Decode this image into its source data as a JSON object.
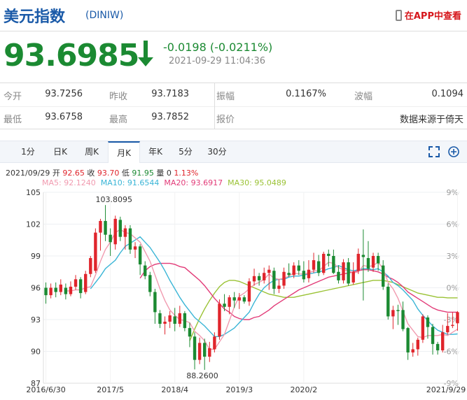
{
  "header": {
    "title": "美元指数",
    "code": "(DINIW)",
    "app_link": "在APP中查看"
  },
  "quote": {
    "price": "93.6985",
    "change": "-0.0198 (-0.0211%)",
    "datetime": "2021-09-29 11:04:36"
  },
  "stats": {
    "open_label": "今开",
    "open": "93.7256",
    "prev_label": "昨收",
    "prev": "93.7183",
    "amp_label": "振幅",
    "amp": "0.1167%",
    "wave_label": "波幅",
    "wave": "0.1094",
    "low_label": "最低",
    "low": "93.6758",
    "high_label": "最高",
    "high": "93.7852",
    "quote_label": "报价",
    "source": "数据来源于倚天"
  },
  "tabs": [
    "1分",
    "日K",
    "周K",
    "月K",
    "年K",
    "5分",
    "30分"
  ],
  "active_tab": "月K",
  "candle_info": {
    "date": "2021/09/29",
    "open_l": "开",
    "open": "92.65",
    "close_l": "收",
    "close": "93.70",
    "low_l": "低",
    "low": "91.95",
    "vol_l": "量",
    "vol": "0",
    "pct": "1.13%"
  },
  "ma_info": {
    "ma5": "MA5: 92.1240",
    "ma10": "MA10: 91.6544",
    "ma20": "MA20: 93.6917",
    "ma30": "MA30: 95.0489"
  },
  "chart_data": {
    "type": "candlestick",
    "y_ticks": [
      "105",
      "102",
      "99",
      "96",
      "93",
      "90",
      "87"
    ],
    "pct_ticks": [
      "9%",
      "6%",
      "3%",
      "0%",
      "-3%",
      "-6%",
      "-9%"
    ],
    "x_ticks": [
      "2016/6/30",
      "2017/5",
      "2018/4",
      "2019/3",
      "2020/2",
      "2021/9/29"
    ],
    "ylim": [
      87,
      105
    ],
    "annotations": {
      "max": "103.8095",
      "min": "88.2600"
    },
    "candles": [
      [
        96,
        95.3,
        96.5,
        94.5
      ],
      [
        95.3,
        96,
        96.4,
        95
      ],
      [
        96,
        95.6,
        96.5,
        95.1
      ],
      [
        95.6,
        96.3,
        96.8,
        95.3
      ],
      [
        96,
        95.4,
        96.4,
        94.9
      ],
      [
        95.4,
        96.1,
        96.6,
        95.2
      ],
      [
        96.1,
        96.8,
        97.2,
        95.8
      ],
      [
        96.8,
        95.5,
        97,
        95
      ],
      [
        95.6,
        97.3,
        97.6,
        95.4
      ],
      [
        97.3,
        98.8,
        99,
        97
      ],
      [
        97.6,
        101.2,
        101.6,
        97.4
      ],
      [
        101.2,
        102.3,
        102.5,
        99.5
      ],
      [
        102.3,
        101,
        103.8,
        100.4
      ],
      [
        101,
        100.3,
        101.6,
        99
      ],
      [
        100.1,
        102.5,
        102.8,
        99.6
      ],
      [
        102.4,
        100.8,
        102.7,
        100.4
      ],
      [
        100.8,
        101.6,
        101.9,
        99.6
      ],
      [
        101.6,
        99.6,
        101.9,
        99.2
      ],
      [
        99.6,
        99.9,
        100.3,
        98.8
      ],
      [
        99.9,
        98.2,
        100.1,
        97.2
      ],
      [
        98.1,
        97.1,
        98.5,
        96.8
      ],
      [
        97.2,
        95.6,
        97.5,
        95.2
      ],
      [
        95.6,
        93.7,
        95.9,
        92.6
      ],
      [
        93.6,
        92.6,
        93.9,
        92.2
      ],
      [
        92.6,
        92.8,
        93.3,
        91.6
      ],
      [
        92.8,
        93.4,
        93.8,
        92.2
      ],
      [
        93.3,
        92.6,
        94.1,
        91.9
      ],
      [
        92.6,
        93.6,
        94.3,
        92.3
      ],
      [
        93.6,
        92.2,
        93.8,
        91.9
      ],
      [
        92.2,
        91.4,
        92.7,
        90.4
      ],
      [
        91.4,
        89.2,
        91.8,
        88.3
      ],
      [
        89.2,
        90.8,
        91.3,
        88.8
      ],
      [
        90.8,
        89.5,
        91.2,
        88.26
      ],
      [
        89.5,
        90.3,
        90.9,
        89.0
      ],
      [
        90.2,
        91.4,
        91.8,
        89.9
      ],
      [
        91.4,
        94.5,
        94.9,
        91.1
      ],
      [
        94.5,
        94.2,
        95.4,
        93.8
      ],
      [
        94.2,
        95.1,
        95.3,
        93.5
      ],
      [
        95.1,
        94.8,
        95.6,
        94.1
      ],
      [
        94.8,
        95.1,
        95.5,
        94.0
      ],
      [
        95.1,
        94.7,
        95.3,
        94.5
      ],
      [
        94.7,
        96.6,
        96.9,
        94.3
      ],
      [
        96.6,
        97.1,
        97.8,
        96.2
      ],
      [
        97.1,
        96.7,
        97.4,
        96.2
      ],
      [
        96.7,
        97.4,
        97.9,
        96.4
      ],
      [
        97.4,
        97.7,
        98.1,
        95.8
      ],
      [
        97.6,
        95.9,
        97.9,
        95.4
      ],
      [
        95.9,
        96.2,
        96.8,
        95.5
      ],
      [
        96.2,
        97.5,
        97.9,
        95.9
      ],
      [
        97.4,
        97.2,
        98.3,
        97
      ],
      [
        97.2,
        98.1,
        98.4,
        96.9
      ],
      [
        98.1,
        97.6,
        98.6,
        97.2
      ],
      [
        97.6,
        96.8,
        98.5,
        96.5
      ],
      [
        96.9,
        97.7,
        98.6,
        96.5
      ],
      [
        97.7,
        98.6,
        99.3,
        97.4
      ],
      [
        98.5,
        97.4,
        99.1,
        97.1
      ],
      [
        97.4,
        99.2,
        99.4,
        97.2
      ],
      [
        99.2,
        99,
        99.6,
        98
      ],
      [
        99,
        97.4,
        99.6,
        97.3
      ],
      [
        97.5,
        96.7,
        98.1,
        96.4
      ],
      [
        96.7,
        98.4,
        98.7,
        96.4
      ],
      [
        98.4,
        96.4,
        98.8,
        96.2
      ],
      [
        96.5,
        97.5,
        98.4,
        96.3
      ],
      [
        97.6,
        99.2,
        99.7,
        97.3
      ],
      [
        99.1,
        98.9,
        101.5,
        94.8
      ],
      [
        98.8,
        97.8,
        100.4,
        97.5
      ],
      [
        97.9,
        99,
        99.3,
        97.5
      ],
      [
        99,
        98.3,
        99.3,
        97.6
      ],
      [
        98.1,
        96.1,
        98.6,
        95.8
      ],
      [
        96.1,
        93.3,
        96.4,
        93
      ],
      [
        93.3,
        93.9,
        94.3,
        92.1
      ],
      [
        93.9,
        93.8,
        94.4,
        92.5
      ],
      [
        93.9,
        92.1,
        94.7,
        91.9
      ],
      [
        92.2,
        89.9,
        92.3,
        89.2
      ],
      [
        89.9,
        90.2,
        90.8,
        89.5
      ],
      [
        90.2,
        91.1,
        91.3,
        89.6
      ],
      [
        91.1,
        93.3,
        93.5,
        90.8
      ],
      [
        93.2,
        92.3,
        93.4,
        91.2
      ],
      [
        92.3,
        90.7,
        92.6,
        89.7
      ],
      [
        90.7,
        90.1,
        90.9,
        89.7
      ],
      [
        90.1,
        91.8,
        92.5,
        89.9
      ],
      [
        91.8,
        92.4,
        93.6,
        91.6
      ],
      [
        92.4,
        92.5,
        93.7,
        92.2
      ],
      [
        92.65,
        93.7,
        93.8,
        91.95
      ]
    ],
    "ma5": [
      null,
      null,
      null,
      null,
      95.7,
      95.7,
      95.8,
      95.8,
      96,
      96.1,
      97.2,
      98.5,
      99.6,
      100.3,
      101.2,
      101.5,
      101.2,
      101.1,
      100.7,
      100.3,
      99.4,
      98.5,
      97.2,
      95.9,
      94.8,
      93.9,
      93.4,
      93,
      92.9,
      92.7,
      91.9,
      91.5,
      91,
      90.2,
      90.2,
      90.9,
      91.6,
      92.9,
      94.2,
      95.2,
      95.5,
      95.9,
      96.3,
      96.5,
      96.8,
      97.3,
      96.9,
      96.8,
      96.9,
      97.1,
      97.4,
      97.3,
      97.3,
      97.4,
      97.6,
      97.6,
      98,
      98.4,
      98.3,
      97.9,
      97.7,
      97.6,
      97.4,
      97.5,
      98.1,
      98,
      98.1,
      98.4,
      97.8,
      96.5,
      95.9,
      95,
      93.8,
      92.6,
      92,
      91.4,
      91.3,
      91.5,
      91.5,
      91.5,
      91.6,
      91.5,
      91.8,
      92.1
    ],
    "ma10": [
      null,
      null,
      null,
      null,
      null,
      null,
      null,
      null,
      null,
      95.9,
      96.5,
      97.1,
      97.8,
      98.2,
      98.6,
      99.3,
      99.9,
      100.2,
      100.5,
      100.8,
      100.3,
      99.8,
      99.1,
      98.4,
      97.6,
      96.7,
      95.9,
      95.1,
      94.4,
      93.8,
      93.2,
      92.8,
      92.4,
      91.9,
      91.4,
      91.4,
      91.6,
      91.9,
      92.2,
      92.7,
      93.2,
      93.7,
      94.6,
      95.4,
      96,
      96.4,
      96.7,
      96.8,
      96.8,
      97,
      97.1,
      97.1,
      97.2,
      97.3,
      97.4,
      97.5,
      97.6,
      97.8,
      97.9,
      98.1,
      97.9,
      97.7,
      97.6,
      97.7,
      97.8,
      97.8,
      97.7,
      97.8,
      97.5,
      97.1,
      96.5,
      96.2,
      95.8,
      95.3,
      94.8,
      94,
      93.4,
      92.9,
      92.4,
      92,
      91.8,
      91.6,
      91.6,
      91.65
    ],
    "ma20": [
      null,
      null,
      null,
      null,
      null,
      null,
      null,
      null,
      null,
      null,
      null,
      null,
      null,
      null,
      null,
      null,
      null,
      null,
      null,
      96.9,
      97.6,
      98,
      98.2,
      98.3,
      98.3,
      98.3,
      98.2,
      98,
      97.9,
      97.5,
      97.1,
      96.7,
      96.2,
      95.6,
      95,
      94.5,
      94,
      93.7,
      93.3,
      93.1,
      93,
      93,
      93.2,
      93.3,
      93.6,
      93.9,
      94.3,
      94.6,
      94.9,
      95.2,
      95.5,
      95.8,
      96,
      96.2,
      96.4,
      96.6,
      96.8,
      97,
      97.1,
      97.2,
      97.3,
      97.4,
      97.5,
      97.6,
      97.7,
      97.7,
      97.6,
      97.5,
      97.3,
      97,
      96.8,
      96.5,
      96.1,
      95.6,
      95.3,
      95,
      94.7,
      94.4,
      94.1,
      93.9,
      93.8,
      93.7,
      93.7,
      93.69
    ],
    "ma30": [
      null,
      null,
      null,
      null,
      null,
      null,
      null,
      null,
      null,
      null,
      null,
      null,
      null,
      null,
      null,
      null,
      null,
      null,
      null,
      null,
      null,
      null,
      null,
      null,
      null,
      null,
      null,
      null,
      null,
      91,
      92.1,
      93.1,
      94,
      94.8,
      95.5,
      96.1,
      96.5,
      96.7,
      96.7,
      96.6,
      96.4,
      96.2,
      96,
      95.8,
      95.6,
      95.4,
      95.3,
      95.2,
      95.1,
      95.1,
      95.1,
      95.2,
      95.3,
      95.4,
      95.5,
      95.6,
      95.7,
      95.8,
      95.9,
      96,
      96.1,
      96.2,
      96.3,
      96.4,
      96.5,
      96.6,
      96.7,
      96.7,
      96.7,
      96.6,
      96.5,
      96.3,
      96.1,
      95.9,
      95.7,
      95.5,
      95.4,
      95.3,
      95.2,
      95.1,
      95.1,
      95.05,
      95.05,
      95.05
    ]
  },
  "colors": {
    "up": "#e0252c",
    "down": "#1b8a32",
    "ma5": "#f19bb0",
    "ma10": "#3ab5d6",
    "ma20": "#e23b78",
    "ma30": "#9ac234",
    "brand": "#1a5aa8"
  }
}
